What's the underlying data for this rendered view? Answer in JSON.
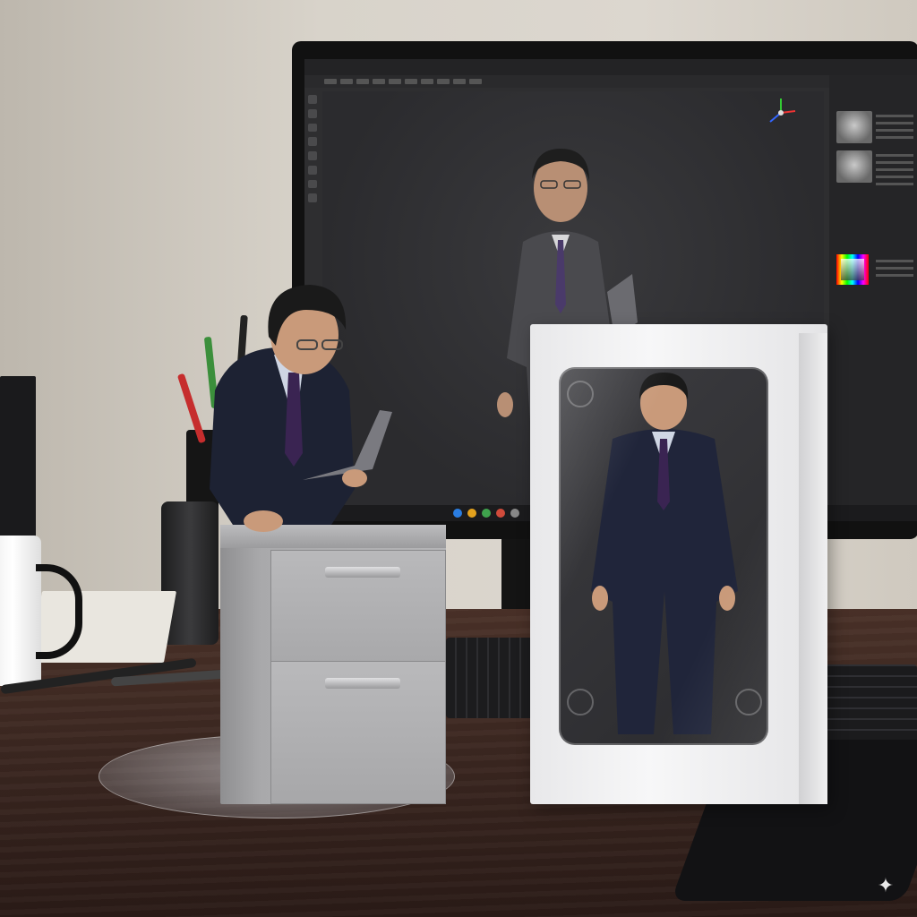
{
  "scene": {
    "subject": "",
    "box_side_text": "",
    "watermark_icon": "sparkle-icon"
  },
  "colors": {
    "suit": "#1d2233",
    "tie": "#3a2452",
    "skin": "#c99a7a",
    "hair": "#1a1a1a",
    "cabinet": "#b0b0b2",
    "box": "#f2f2f3",
    "desk": "#3a2620",
    "screen": "#2e2e30"
  }
}
